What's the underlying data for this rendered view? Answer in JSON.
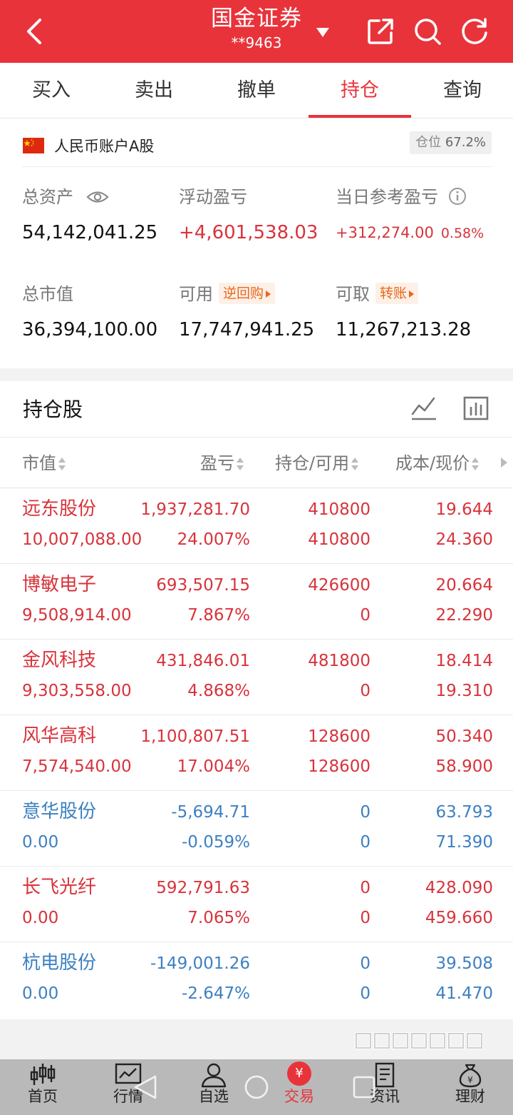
{
  "header": {
    "title": "国金证券",
    "account": "**9463"
  },
  "tabs": [
    "买入",
    "卖出",
    "撤单",
    "持仓",
    "查询"
  ],
  "active_tab": "持仓",
  "account": {
    "label": "人民币账户A股",
    "ratio_label": "仓位",
    "ratio_value": "67.2%"
  },
  "summary": {
    "total_assets_label": "总资产",
    "total_assets": "54,142,041.25",
    "floating_pl_label": "浮动盈亏",
    "floating_pl": "+4,601,538.03",
    "daily_pl_label": "当日参考盈亏",
    "daily_pl": "+312,274.00",
    "daily_pl_pct": "0.58%",
    "market_value_label": "总市值",
    "market_value": "36,394,100.00",
    "available_label": "可用",
    "available": "17,747,941.25",
    "repo_label": "逆回购",
    "withdrawable_label": "可取",
    "withdrawable": "11,267,213.28",
    "transfer_label": "转账"
  },
  "holdings": {
    "title": "持仓股",
    "columns": [
      "市值",
      "盈亏",
      "持仓/可用",
      "成本/现价"
    ],
    "rows": [
      {
        "name": "远东股份",
        "market_value": "10,007,088.00",
        "pl": "1,937,281.70",
        "pl_pct": "24.007%",
        "holding": "410800",
        "available": "410800",
        "cost": "19.644",
        "price": "24.360",
        "color": "#d8333b"
      },
      {
        "name": "博敏电子",
        "market_value": "9,508,914.00",
        "pl": "693,507.15",
        "pl_pct": "7.867%",
        "holding": "426600",
        "available": "0",
        "cost": "20.664",
        "price": "22.290",
        "color": "#d8333b"
      },
      {
        "name": "金风科技",
        "market_value": "9,303,558.00",
        "pl": "431,846.01",
        "pl_pct": "4.868%",
        "holding": "481800",
        "available": "0",
        "cost": "18.414",
        "price": "19.310",
        "color": "#d8333b"
      },
      {
        "name": "风华高科",
        "market_value": "7,574,540.00",
        "pl": "1,100,807.51",
        "pl_pct": "17.004%",
        "holding": "128600",
        "available": "128600",
        "cost": "50.340",
        "price": "58.900",
        "color": "#d8333b"
      },
      {
        "name": "意华股份",
        "market_value": "0.00",
        "pl": "-5,694.71",
        "pl_pct": "-0.059%",
        "holding": "0",
        "available": "0",
        "cost": "63.793",
        "price": "71.390",
        "color": "#3d80c2"
      },
      {
        "name": "长飞光纤",
        "market_value": "0.00",
        "pl": "592,791.63",
        "pl_pct": "7.065%",
        "holding": "0",
        "available": "0",
        "cost": "428.090",
        "price": "459.660",
        "color": "#d8333b"
      },
      {
        "name": "杭电股份",
        "market_value": "0.00",
        "pl": "-149,001.26",
        "pl_pct": "-2.647%",
        "holding": "0",
        "available": "0",
        "cost": "39.508",
        "price": "41.470",
        "color": "#3d80c2"
      }
    ]
  },
  "nav": [
    {
      "label": "首页",
      "icon": "candlestick-icon"
    },
    {
      "label": "行情",
      "icon": "chart-line-icon"
    },
    {
      "label": "自选",
      "icon": "user-icon"
    },
    {
      "label": "交易",
      "icon": "yuan-icon"
    },
    {
      "label": "资讯",
      "icon": "document-icon"
    },
    {
      "label": "理财",
      "icon": "money-bag-icon"
    }
  ],
  "nav_active": "交易",
  "colors": {
    "brand": "#e8333b",
    "gain": "#d8333b",
    "loss": "#3d80c2",
    "accent_orange": "#e8671f"
  }
}
